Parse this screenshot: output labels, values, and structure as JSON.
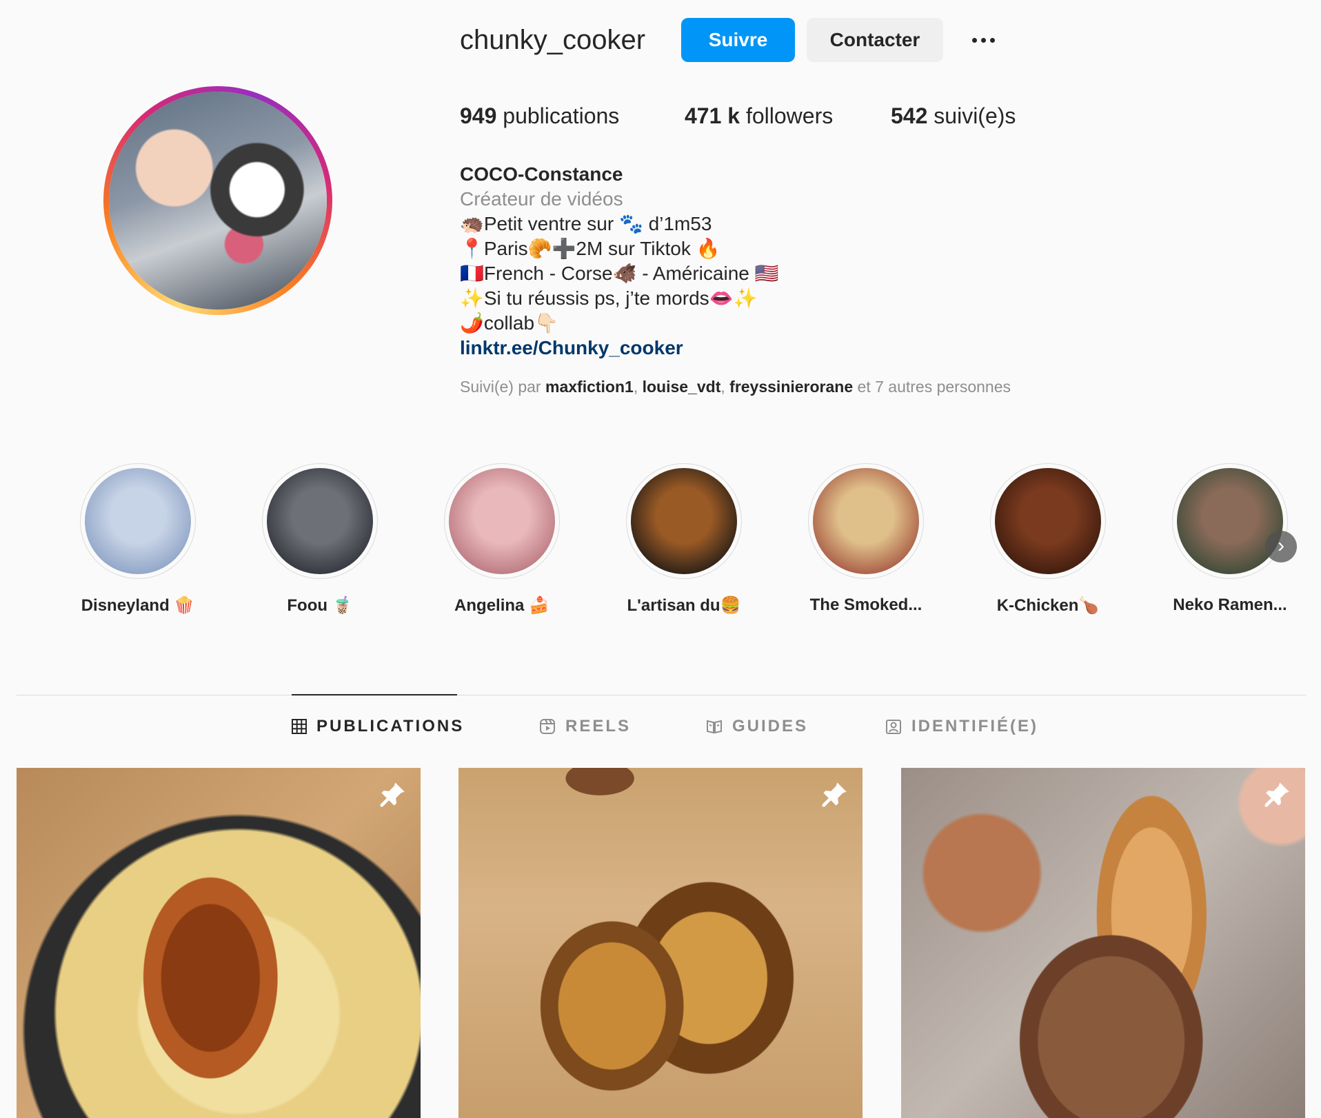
{
  "profile": {
    "username": "chunky_cooker",
    "follow_label": "Suivre",
    "contact_label": "Contacter",
    "stats": {
      "posts_count": "949",
      "posts_label": "publications",
      "followers_count": "471 k",
      "followers_label": "followers",
      "following_count": "542",
      "following_label": "suivi(e)s"
    },
    "display_name": "COCO-Constance",
    "category": "Créateur de vidéos",
    "bio_lines": [
      "🦔Petit ventre sur 🐾 d’1m53",
      "📍Paris🥐➕2M sur Tiktok 🔥",
      "🇫🇷French - Corse🐗 - Américaine 🇺🇸",
      "✨Si tu réussis ps, j’te mords👄✨",
      "🌶️collab👇🏻"
    ],
    "link": "linktr.ee/Chunky_cooker",
    "followed_by": {
      "prefix": "Suivi(e) par",
      "users": [
        "maxfiction1",
        "louise_vdt",
        "freyssinierorane"
      ],
      "suffix": "et 7 autres personnes"
    }
  },
  "highlights": [
    {
      "label": "Disneyland 🍿",
      "color_a": "#c7d3e6",
      "color_b": "#8aa0c4"
    },
    {
      "label": "Foou 🧋",
      "color_a": "#6e7078",
      "color_b": "#2e3138"
    },
    {
      "label": "Angelina 🍰",
      "color_a": "#e8b8bb",
      "color_b": "#b7747c"
    },
    {
      "label": "L'artisan du🍔",
      "color_a": "#9a5a25",
      "color_b": "#1f1a16"
    },
    {
      "label": "The Smoked...",
      "color_a": "#e0c08a",
      "color_b": "#a3523f"
    },
    {
      "label": "K-Chicken🍗",
      "color_a": "#7a3a1f",
      "color_b": "#3a1a0d"
    },
    {
      "label": "Neko Ramen...",
      "color_a": "#8a6a58",
      "color_b": "#3a4a38"
    }
  ],
  "tabs": [
    {
      "label": "PUBLICATIONS",
      "icon": "grid-icon",
      "active": true
    },
    {
      "label": "REELS",
      "icon": "reels-icon",
      "active": false
    },
    {
      "label": "GUIDES",
      "icon": "guides-icon",
      "active": false
    },
    {
      "label": "IDENTIFIÉ(E)",
      "icon": "tagged-icon",
      "active": false
    }
  ],
  "posts": [
    {
      "subject": "grilled chicken on pasta shells",
      "pinned": true
    },
    {
      "subject": "french toast brioche",
      "pinned": true
    },
    {
      "subject": "sugared churro dipped in chocolate",
      "pinned": true
    }
  ],
  "colors": {
    "accent": "#0095f6",
    "link": "#00376b",
    "muted": "#8e8e8e",
    "text": "#262626"
  }
}
